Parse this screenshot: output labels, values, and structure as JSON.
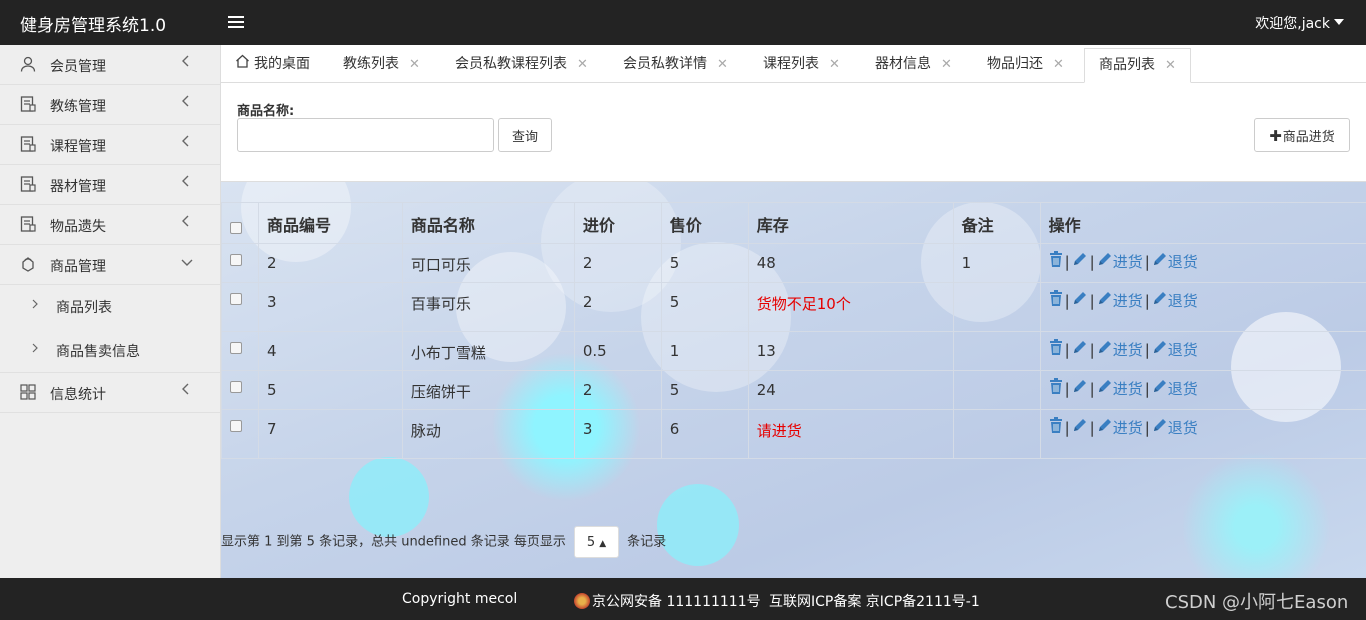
{
  "header": {
    "title": "健身房管理系统1.0",
    "user_label": "欢迎您,jack"
  },
  "sidebar": {
    "items": [
      {
        "label": "会员管理",
        "icon": "user-icon",
        "arrow": "<"
      },
      {
        "label": "教练管理",
        "icon": "document-icon",
        "arrow": "<"
      },
      {
        "label": "课程管理",
        "icon": "document-icon",
        "arrow": "<"
      },
      {
        "label": "器材管理",
        "icon": "document-icon",
        "arrow": "<"
      },
      {
        "label": "物品遗失",
        "icon": "document-icon",
        "arrow": "<"
      },
      {
        "label": "商品管理",
        "icon": "package-icon",
        "arrow": "expanded"
      },
      {
        "label": "信息统计",
        "icon": "grid-icon",
        "arrow": "<"
      }
    ],
    "subitems": [
      {
        "label": "商品列表"
      },
      {
        "label": "商品售卖信息"
      }
    ]
  },
  "tabs": [
    {
      "label": "我的桌面",
      "closable": false
    },
    {
      "label": "教练列表",
      "closable": true
    },
    {
      "label": "会员私教课程列表",
      "closable": true
    },
    {
      "label": "会员私教详情",
      "closable": true
    },
    {
      "label": "课程列表",
      "closable": true
    },
    {
      "label": "器材信息",
      "closable": true
    },
    {
      "label": "物品归还",
      "closable": true
    },
    {
      "label": "商品列表",
      "closable": true,
      "active": true
    }
  ],
  "tab_close_glyph": "✕",
  "search": {
    "label": "商品名称:",
    "value": "",
    "placeholder": "",
    "query_button": "查询",
    "purchase_button": "商品进货"
  },
  "table": {
    "columns": [
      "商品编号",
      "商品名称",
      "进价",
      "售价",
      "库存",
      "备注",
      "操作"
    ],
    "rows": [
      {
        "id": "2",
        "name": "可口可乐",
        "cost": "2",
        "price": "5",
        "stock": "48",
        "stock_alert": false,
        "note": "1"
      },
      {
        "id": "3",
        "name": "百事可乐",
        "cost": "2",
        "price": "5",
        "stock": "货物不足10个",
        "stock_alert": true,
        "note": ""
      },
      {
        "id": "4",
        "name": "小布丁雪糕",
        "cost": "0.5",
        "price": "1",
        "stock": "13",
        "stock_alert": false,
        "note": ""
      },
      {
        "id": "5",
        "name": "压缩饼干",
        "cost": "2",
        "price": "5",
        "stock": "24",
        "stock_alert": false,
        "note": ""
      },
      {
        "id": "7",
        "name": "脉动",
        "cost": "3",
        "price": "6",
        "stock": "请进货",
        "stock_alert": true,
        "note": ""
      }
    ],
    "actions": {
      "restock": "进货",
      "return": "退货"
    }
  },
  "pagination": {
    "prefix": "显示第 1 到第 5 条记录，总共 undefined 条记录 每页显示",
    "page_size": "5",
    "suffix": "条记录"
  },
  "footer": {
    "copyright": "Copyright mecol",
    "police": "京公网安备 111111111号",
    "icp": "互联网ICP备案 京ICP备2111号-1",
    "watermark": "CSDN @小阿七Eason"
  },
  "colors": {
    "header_bg": "#232323",
    "link": "#3a7fc2",
    "alert": "#e60000",
    "sidebar_bg": "#eeeeee"
  }
}
